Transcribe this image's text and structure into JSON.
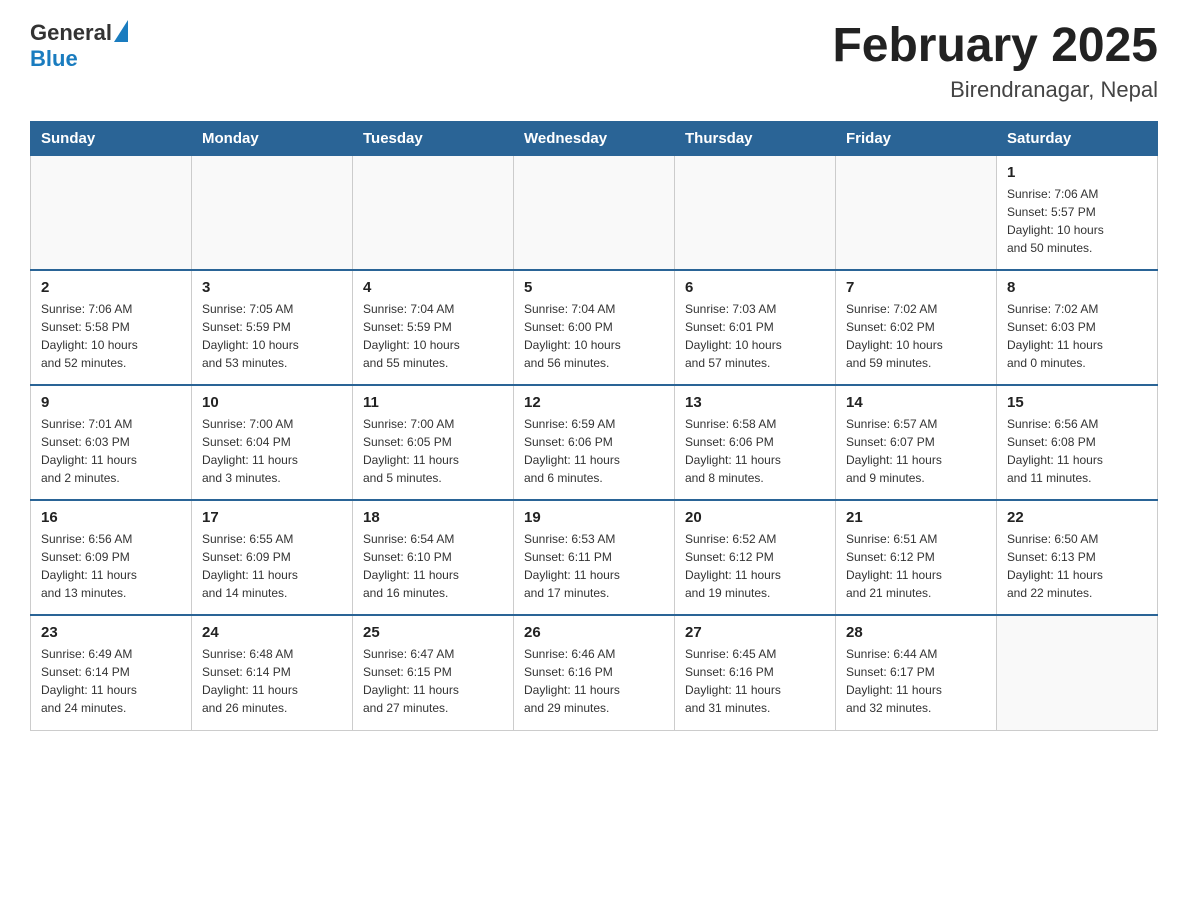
{
  "header": {
    "logo_general": "General",
    "logo_blue": "Blue",
    "title": "February 2025",
    "location": "Birendranagar, Nepal"
  },
  "days_of_week": [
    "Sunday",
    "Monday",
    "Tuesday",
    "Wednesday",
    "Thursday",
    "Friday",
    "Saturday"
  ],
  "weeks": [
    [
      {
        "day": "",
        "info": ""
      },
      {
        "day": "",
        "info": ""
      },
      {
        "day": "",
        "info": ""
      },
      {
        "day": "",
        "info": ""
      },
      {
        "day": "",
        "info": ""
      },
      {
        "day": "",
        "info": ""
      },
      {
        "day": "1",
        "info": "Sunrise: 7:06 AM\nSunset: 5:57 PM\nDaylight: 10 hours\nand 50 minutes."
      }
    ],
    [
      {
        "day": "2",
        "info": "Sunrise: 7:06 AM\nSunset: 5:58 PM\nDaylight: 10 hours\nand 52 minutes."
      },
      {
        "day": "3",
        "info": "Sunrise: 7:05 AM\nSunset: 5:59 PM\nDaylight: 10 hours\nand 53 minutes."
      },
      {
        "day": "4",
        "info": "Sunrise: 7:04 AM\nSunset: 5:59 PM\nDaylight: 10 hours\nand 55 minutes."
      },
      {
        "day": "5",
        "info": "Sunrise: 7:04 AM\nSunset: 6:00 PM\nDaylight: 10 hours\nand 56 minutes."
      },
      {
        "day": "6",
        "info": "Sunrise: 7:03 AM\nSunset: 6:01 PM\nDaylight: 10 hours\nand 57 minutes."
      },
      {
        "day": "7",
        "info": "Sunrise: 7:02 AM\nSunset: 6:02 PM\nDaylight: 10 hours\nand 59 minutes."
      },
      {
        "day": "8",
        "info": "Sunrise: 7:02 AM\nSunset: 6:03 PM\nDaylight: 11 hours\nand 0 minutes."
      }
    ],
    [
      {
        "day": "9",
        "info": "Sunrise: 7:01 AM\nSunset: 6:03 PM\nDaylight: 11 hours\nand 2 minutes."
      },
      {
        "day": "10",
        "info": "Sunrise: 7:00 AM\nSunset: 6:04 PM\nDaylight: 11 hours\nand 3 minutes."
      },
      {
        "day": "11",
        "info": "Sunrise: 7:00 AM\nSunset: 6:05 PM\nDaylight: 11 hours\nand 5 minutes."
      },
      {
        "day": "12",
        "info": "Sunrise: 6:59 AM\nSunset: 6:06 PM\nDaylight: 11 hours\nand 6 minutes."
      },
      {
        "day": "13",
        "info": "Sunrise: 6:58 AM\nSunset: 6:06 PM\nDaylight: 11 hours\nand 8 minutes."
      },
      {
        "day": "14",
        "info": "Sunrise: 6:57 AM\nSunset: 6:07 PM\nDaylight: 11 hours\nand 9 minutes."
      },
      {
        "day": "15",
        "info": "Sunrise: 6:56 AM\nSunset: 6:08 PM\nDaylight: 11 hours\nand 11 minutes."
      }
    ],
    [
      {
        "day": "16",
        "info": "Sunrise: 6:56 AM\nSunset: 6:09 PM\nDaylight: 11 hours\nand 13 minutes."
      },
      {
        "day": "17",
        "info": "Sunrise: 6:55 AM\nSunset: 6:09 PM\nDaylight: 11 hours\nand 14 minutes."
      },
      {
        "day": "18",
        "info": "Sunrise: 6:54 AM\nSunset: 6:10 PM\nDaylight: 11 hours\nand 16 minutes."
      },
      {
        "day": "19",
        "info": "Sunrise: 6:53 AM\nSunset: 6:11 PM\nDaylight: 11 hours\nand 17 minutes."
      },
      {
        "day": "20",
        "info": "Sunrise: 6:52 AM\nSunset: 6:12 PM\nDaylight: 11 hours\nand 19 minutes."
      },
      {
        "day": "21",
        "info": "Sunrise: 6:51 AM\nSunset: 6:12 PM\nDaylight: 11 hours\nand 21 minutes."
      },
      {
        "day": "22",
        "info": "Sunrise: 6:50 AM\nSunset: 6:13 PM\nDaylight: 11 hours\nand 22 minutes."
      }
    ],
    [
      {
        "day": "23",
        "info": "Sunrise: 6:49 AM\nSunset: 6:14 PM\nDaylight: 11 hours\nand 24 minutes."
      },
      {
        "day": "24",
        "info": "Sunrise: 6:48 AM\nSunset: 6:14 PM\nDaylight: 11 hours\nand 26 minutes."
      },
      {
        "day": "25",
        "info": "Sunrise: 6:47 AM\nSunset: 6:15 PM\nDaylight: 11 hours\nand 27 minutes."
      },
      {
        "day": "26",
        "info": "Sunrise: 6:46 AM\nSunset: 6:16 PM\nDaylight: 11 hours\nand 29 minutes."
      },
      {
        "day": "27",
        "info": "Sunrise: 6:45 AM\nSunset: 6:16 PM\nDaylight: 11 hours\nand 31 minutes."
      },
      {
        "day": "28",
        "info": "Sunrise: 6:44 AM\nSunset: 6:17 PM\nDaylight: 11 hours\nand 32 minutes."
      },
      {
        "day": "",
        "info": ""
      }
    ]
  ]
}
